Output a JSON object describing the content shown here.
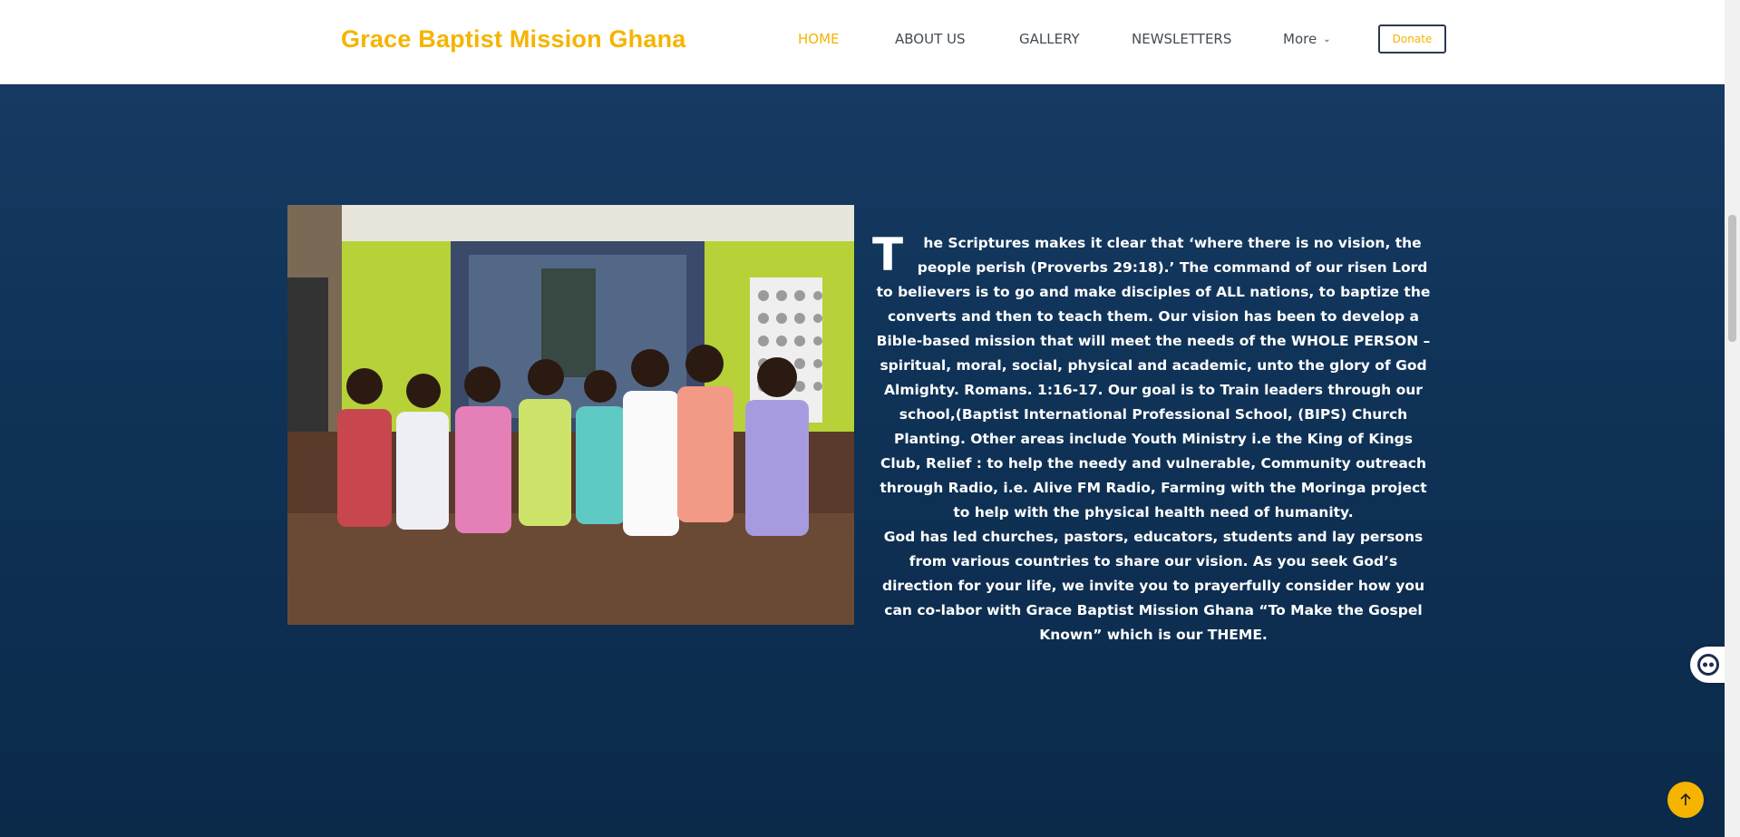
{
  "site": {
    "brand": "Grace Baptist Mission Ghana",
    "accent_color": "#f5b400",
    "hero_background": "#0d2d4e"
  },
  "nav": {
    "items": [
      {
        "label": "HOME",
        "active": true
      },
      {
        "label": "ABOUT US",
        "active": false
      },
      {
        "label": "GALLERY",
        "active": false
      },
      {
        "label": "NEWSLETTERS",
        "active": false
      },
      {
        "label": "More",
        "active": false,
        "icon": "chevron-down-icon"
      }
    ],
    "donate_label": "Donate"
  },
  "hero": {
    "dropcap": "T",
    "paragraph1": "he Scriptures makes it clear that ‘where there is no vision, the people perish (Proverbs 29:18).’ The command of our risen Lord to believers is to go and make disciples of ALL nations, to baptize the converts and then to teach them. Our vision has been to develop a Bible-based mission that will meet the needs of the WHOLE PERSON – spiritual, moral, social, physical and academic, unto the glory of God Almighty. Romans. 1:16-17. Our goal is to Train leaders through our school,(Baptist International Professional School, (BIPS) Church Planting. Other areas include Youth Ministry i.e the King of Kings Club, Relief : to help the needy and vulnerable, Community outreach through Radio, i.e. Alive FM Radio, Farming with the Moringa project to help with the physical health need of humanity.",
    "paragraph2": "God has led churches, pastors, educators, students and lay persons from various countries to share our vision. As you seek God’s direction for your life, we invite you to prayerfully consider how you can co-labor with Grace Baptist Mission Ghana “To Make the Gospel Known” which is our THEME.",
    "photo_icon": "children-group-photo"
  },
  "widgets": {
    "chat_icon": "chat-bot-icon",
    "back_to_top_icon": "arrow-up-icon"
  }
}
